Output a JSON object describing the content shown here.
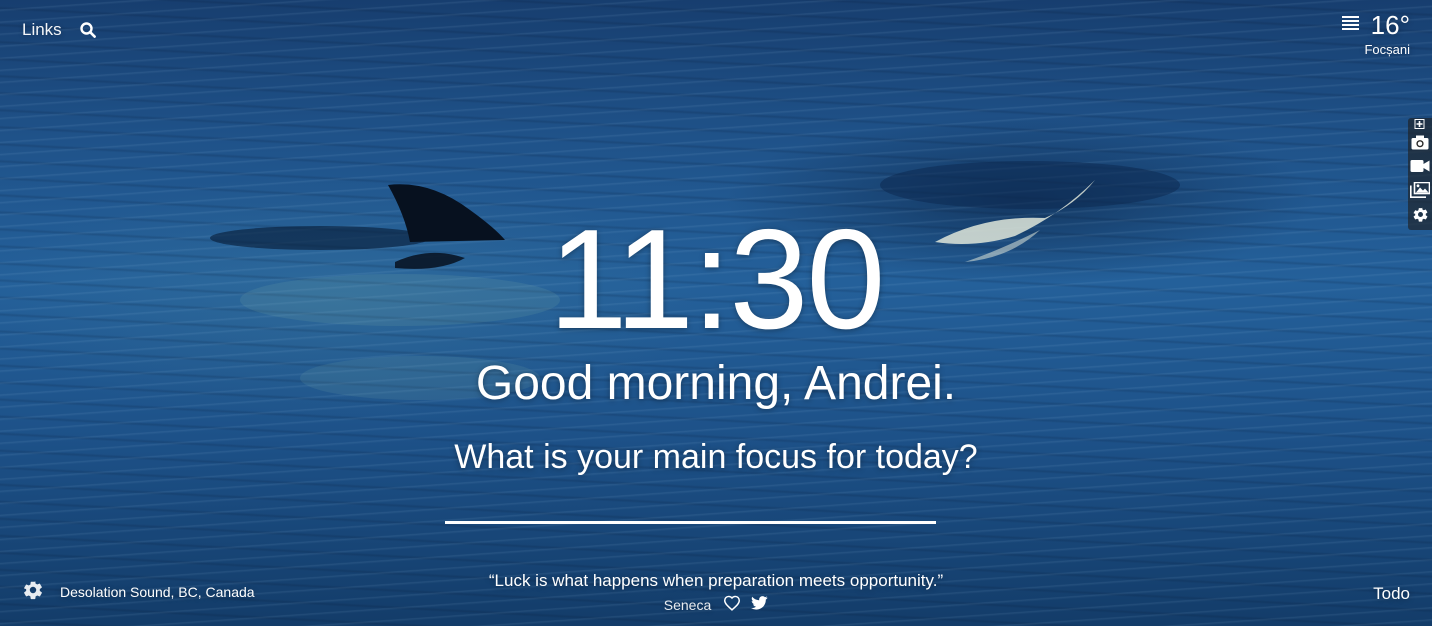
{
  "top_left": {
    "links_label": "Links",
    "search_icon": "search-icon"
  },
  "weather": {
    "menu_icon": "menu-icon",
    "temperature": "16°",
    "location": "Focșani"
  },
  "sidebar": {
    "tools": [
      "add-icon",
      "camera-icon",
      "video-icon",
      "gallery-icon",
      "gear-icon"
    ]
  },
  "center": {
    "time": "11:30",
    "greeting": "Good morning, Andrei.",
    "focus_prompt": "What is your main focus for today?",
    "focus_value": ""
  },
  "bottom": {
    "settings_icon": "gear-icon",
    "photo_location": "Desolation Sound, BC, Canada",
    "quote": "“Luck is what happens when preparation meets opportunity.”",
    "quote_author": "Seneca",
    "heart_icon": "heart-icon",
    "twitter_icon": "twitter-icon",
    "todo_label": "Todo"
  },
  "colors": {
    "water_top": "#173e6f",
    "water_mid": "#24609a",
    "text": "#ffffff"
  }
}
